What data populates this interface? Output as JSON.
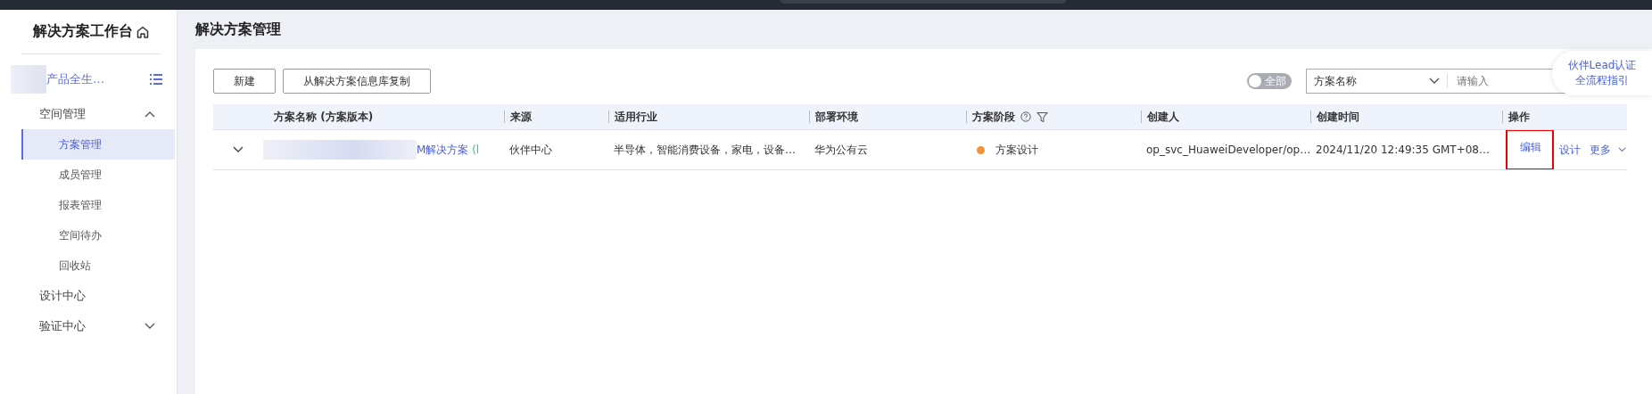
{
  "sidebar": {
    "title": "解决方案工作台",
    "project": {
      "name": "产品全生…"
    },
    "menu": [
      {
        "label": "空间管理",
        "expanded": true,
        "children": [
          {
            "label": "方案管理",
            "selected": true
          },
          {
            "label": "成员管理",
            "selected": false
          },
          {
            "label": "报表管理",
            "selected": false
          },
          {
            "label": "空间待办",
            "selected": false
          },
          {
            "label": "回收站",
            "selected": false
          }
        ]
      },
      {
        "label": "设计中心"
      },
      {
        "label": "验证中心",
        "expanded": false
      }
    ]
  },
  "page_title": "解决方案管理",
  "toolbar": {
    "buttons": [
      "新建",
      "从解决方案信息库复制"
    ],
    "toggle": {
      "label": "全部",
      "on": false
    },
    "filter": {
      "field": "方案名称",
      "placeholder": "请输入"
    }
  },
  "guide_bubble": [
    "伙伴Lead认证",
    "全流程指引"
  ],
  "table": {
    "columns": [
      "方案名称 (方案版本)",
      "来源",
      "适用行业",
      "部署环境",
      "方案阶段",
      "创建人",
      "创建时间",
      "操作"
    ],
    "rows": [
      {
        "expanded": false,
        "name": "M解决方案",
        "version": "(l",
        "source": "伙伴中心",
        "industry": "半导体，智能消费设备，家电，设备…",
        "environment": "华为公有云",
        "stage": {
          "label": "方案设计",
          "color": "#f39333"
        },
        "creator": "op_svc_HuaweiDeveloper/op…",
        "created": "2024/11/20 12:49:35 GMT+08…",
        "actions": [
          {
            "label": "编辑",
            "highlighted": true
          },
          {
            "label": "设计",
            "highlighted": false
          }
        ],
        "more": "更多"
      }
    ]
  }
}
